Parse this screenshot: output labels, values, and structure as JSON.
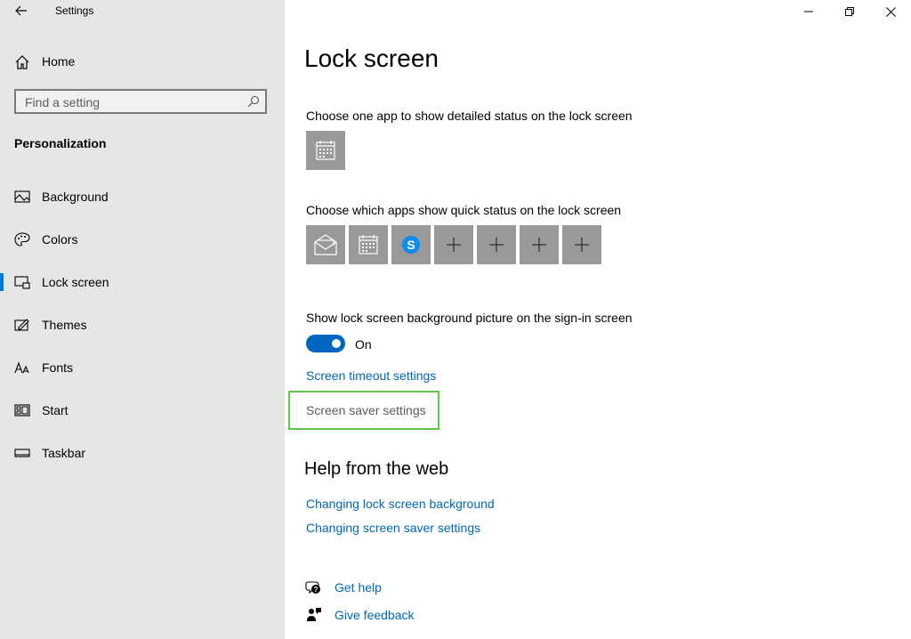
{
  "window": {
    "app_title": "Settings"
  },
  "sidebar": {
    "home_label": "Home",
    "search_placeholder": "Find a setting",
    "section_heading": "Personalization",
    "items": [
      {
        "label": "Background",
        "icon": "picture-icon",
        "selected": false
      },
      {
        "label": "Colors",
        "icon": "palette-icon",
        "selected": false
      },
      {
        "label": "Lock screen",
        "icon": "lock-screen-icon",
        "selected": true
      },
      {
        "label": "Themes",
        "icon": "themes-icon",
        "selected": false
      },
      {
        "label": "Fonts",
        "icon": "fonts-icon",
        "selected": false
      },
      {
        "label": "Start",
        "icon": "start-icon",
        "selected": false
      },
      {
        "label": "Taskbar",
        "icon": "taskbar-icon",
        "selected": false
      }
    ]
  },
  "main": {
    "title": "Lock screen",
    "detailed_status_label": "Choose one app to show detailed status on the lock screen",
    "detailed_status_app": "calendar-icon",
    "quick_status_label": "Choose which apps show quick status on the lock screen",
    "quick_status_apps": [
      "mail-icon",
      "calendar-icon",
      "skype-icon",
      "plus-icon",
      "plus-icon",
      "plus-icon",
      "plus-icon"
    ],
    "signin_picture_label": "Show lock screen background picture on the sign-in screen",
    "signin_picture_toggle": "On",
    "screen_timeout_link": "Screen timeout settings",
    "screen_saver_link": "Screen saver settings",
    "help_heading": "Help from the web",
    "help_links": [
      "Changing lock screen background",
      "Changing screen saver settings"
    ],
    "get_help": "Get help",
    "give_feedback": "Give feedback"
  },
  "colors": {
    "accent": "#0078d7",
    "link": "#0067b8",
    "tile": "#999999",
    "highlight": "#5ec645",
    "sidebar_bg": "#e6e6e6"
  }
}
